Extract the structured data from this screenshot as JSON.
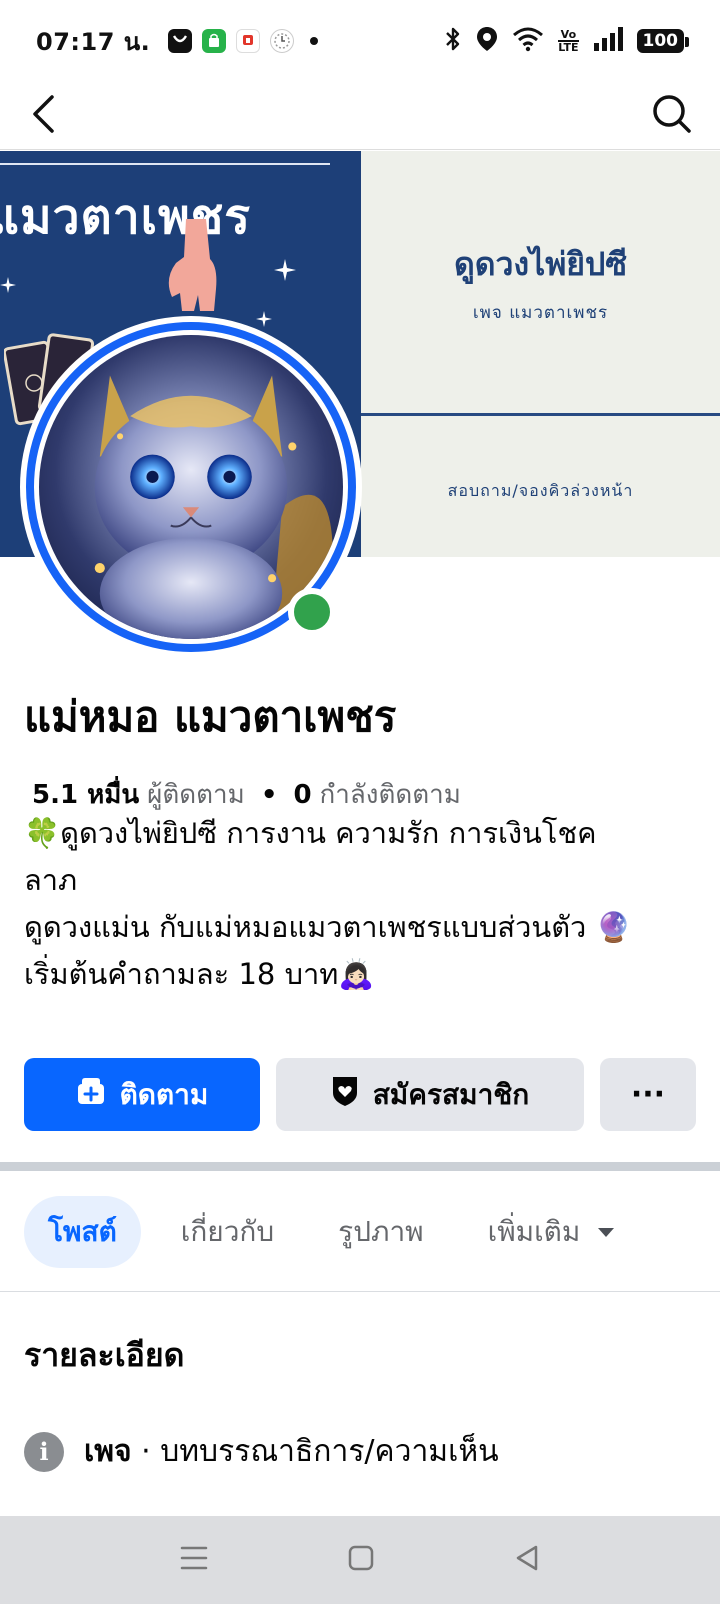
{
  "status_bar": {
    "time": "07:17 น.",
    "battery": "100",
    "network_label": "Vo LTE"
  },
  "app_bar": {
    "back_icon": "back-arrow-icon",
    "search_icon": "search-icon"
  },
  "cover": {
    "left_title": "แมวตาเพชร",
    "right_title": "ดูดวงไพ่ยิปซี",
    "right_subtitle": "เพจ แมวตาเพชร",
    "right_cta": "สอบถาม/จองคิวล่วงหน้า",
    "colors": {
      "left_bg": "#1d3f78",
      "right_bg": "#eef0ea"
    }
  },
  "profile": {
    "name": "แม่หมอ แมวตาเพชร",
    "followers_count": "5.1 หมื่น",
    "followers_label": "ผู้ติดตาม",
    "following_count": "0",
    "following_label": "กำลังติดตาม",
    "bio_lines": [
      "🍀ดูดวงไพ่ยิปซี การงาน ความรัก การเงินโชค",
      "ลาภ",
      "ดูดวงแม่น กับแม่หมอแมวตาเพชรแบบส่วนตัว 🔮",
      "เริ่มต้นคำถามละ 18 บาท🙇🏻‍♀️"
    ],
    "online": true
  },
  "actions": {
    "follow_label": "ติดตาม",
    "subscribe_label": "สมัครสมาชิก",
    "more_label": "···"
  },
  "tabs": [
    {
      "label": "โพสต์",
      "active": true
    },
    {
      "label": "เกี่ยวกับ",
      "active": false
    },
    {
      "label": "รูปภาพ",
      "active": false
    },
    {
      "label": "เพิ่มเติม",
      "active": false
    }
  ],
  "details": {
    "title": "รายละเอียด",
    "page_label": "เพจ",
    "category": "· บทบรรณาธิการ/ความเห็น"
  },
  "colors": {
    "accent": "#0866ff",
    "online": "#31a24c",
    "ring": "#1663f6"
  }
}
